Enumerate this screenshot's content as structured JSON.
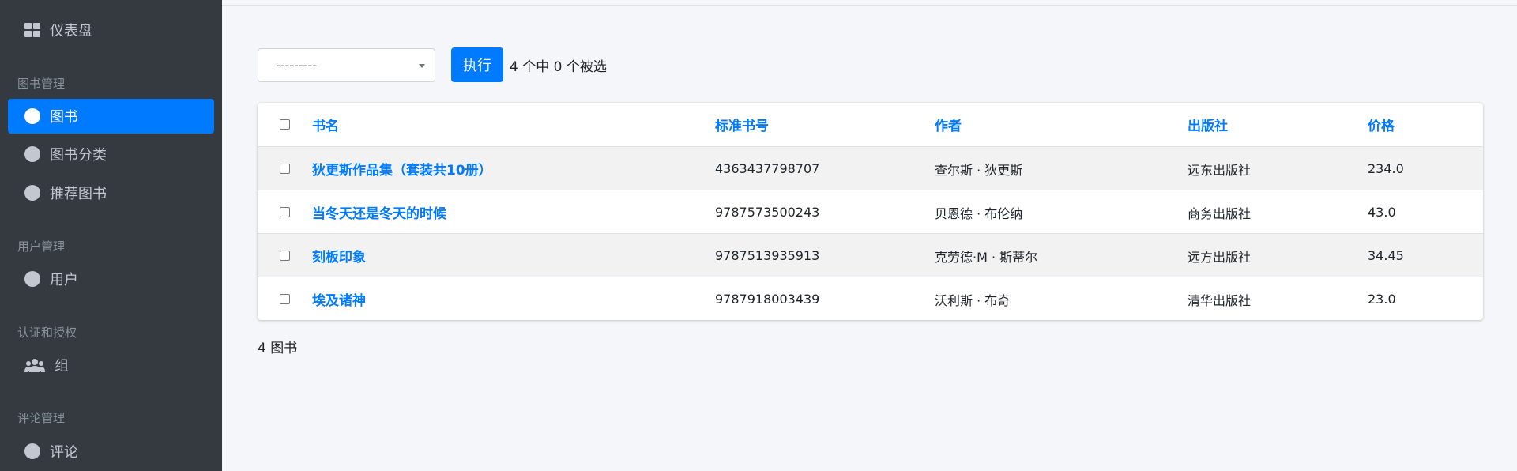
{
  "sidebar": {
    "dashboard": {
      "label": "仪表盘",
      "icon": "dashboard-icon"
    },
    "sections": [
      {
        "header": "图书管理",
        "items": [
          {
            "label": "图书",
            "icon": "circle-icon",
            "active": true
          },
          {
            "label": "图书分类",
            "icon": "circle-icon",
            "active": false
          },
          {
            "label": "推荐图书",
            "icon": "circle-icon",
            "active": false
          }
        ]
      },
      {
        "header": "用户管理",
        "items": [
          {
            "label": "用户",
            "icon": "circle-icon",
            "active": false
          }
        ]
      },
      {
        "header": "认证和授权",
        "items": [
          {
            "label": "组",
            "icon": "users-icon",
            "active": false
          }
        ]
      },
      {
        "header": "评论管理",
        "items": [
          {
            "label": "评论",
            "icon": "circle-icon",
            "active": false
          }
        ]
      }
    ]
  },
  "actions": {
    "select_value": "---------",
    "run_label": "执行",
    "selection_counter": "4 个中 0 个被选"
  },
  "table": {
    "columns": [
      "书名",
      "标准书号",
      "作者",
      "出版社",
      "价格"
    ],
    "rows": [
      {
        "title": "狄更斯作品集（套装共10册）",
        "isbn": "4363437798707",
        "author": "查尔斯 · 狄更斯",
        "publisher": "远东出版社",
        "price": "234.0"
      },
      {
        "title": "当冬天还是冬天的时候",
        "isbn": "9787573500243",
        "author": "贝恩德 · 布伦纳",
        "publisher": "商务出版社",
        "price": "43.0"
      },
      {
        "title": "刻板印象",
        "isbn": "9787513935913",
        "author": "克劳德·M · 斯蒂尔",
        "publisher": "远方出版社",
        "price": "34.45"
      },
      {
        "title": "埃及诸神",
        "isbn": "9787918003439",
        "author": "沃利斯 · 布奇",
        "publisher": "清华出版社",
        "price": "23.0"
      }
    ]
  },
  "footer": {
    "count": "4 图书"
  },
  "colors": {
    "accent": "#007bff",
    "sidebar_bg": "#343a40",
    "page_bg": "#f4f6f9"
  }
}
